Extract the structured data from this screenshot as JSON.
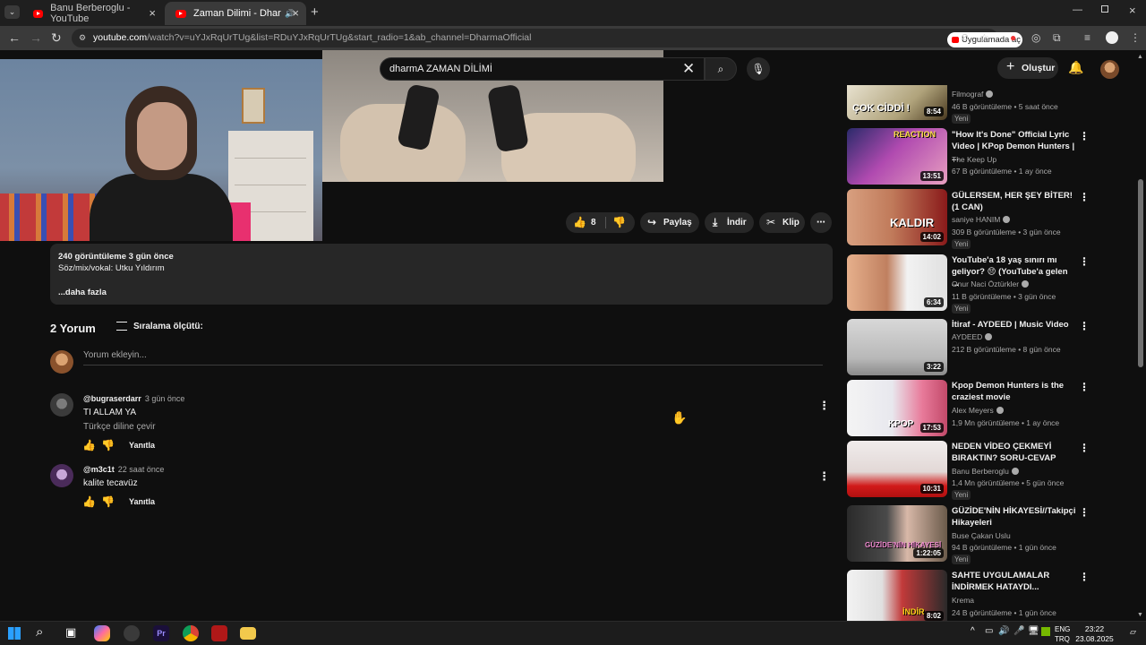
{
  "browser": {
    "tabs": [
      {
        "title": "Banu Berberoglu - YouTube",
        "active": false
      },
      {
        "title": "Zaman Dilimi - Dharma (Off",
        "active": true
      }
    ],
    "new_tab": "+",
    "url_domain": "youtube.com",
    "url_path": "/watch?v=uYJxRqUrTUg&list=RDuYJxRqUrTUg&start_radio=1&ab_channel=DharmaOfficial",
    "open_in_app": "Uygulamada aç"
  },
  "youtube": {
    "search_value": "dharmA ZAMAN DİLİMİ",
    "create_label": "Oluştur",
    "actions": {
      "likes": "8",
      "share": "Paylaş",
      "download": "İndir",
      "clip": "Klip"
    },
    "description": {
      "meta": "240 görüntüleme  3 gün önce",
      "line1": "Söz/mix/vokal: Utku Yıldırım",
      "more": "...daha fazla"
    },
    "comments_header": {
      "count": "2 Yorum",
      "sort": "Sıralama ölçütü:",
      "add_placeholder": "Yorum ekleyin..."
    },
    "comments": [
      {
        "user": "@bugraserdarr",
        "ago": "3 gün önce",
        "text": "TI ALLAM YA",
        "translate": "Türkçe diline çevir",
        "reply": "Yanıtla"
      },
      {
        "user": "@m3c1t",
        "ago": "22 saat önce",
        "text": "kalite tecavüz",
        "reply": "Yanıtla"
      }
    ],
    "sidebar": [
      {
        "title": "",
        "channel": "Filmograf",
        "meta": "46 B görüntüleme • 5 saat önce",
        "new": "Yeni",
        "duration": "8:54",
        "overlay": "ÇOK CİDDİ !"
      },
      {
        "title": "\"How It's Done\" Official Lyric Video | KPop Demon Hunters | ...",
        "channel": "The Keep Up",
        "meta": "67 B görüntüleme • 1 ay önce",
        "duration": "13:51",
        "overlay": "REACTION"
      },
      {
        "title": "GÜLERSEM, HER ŞEY BİTER! (1 CAN)",
        "channel": "saniye HANIM",
        "meta": "309 B görüntüleme • 3 gün önce",
        "new": "Yeni",
        "duration": "14:02",
        "overlay": "KALDIR"
      },
      {
        "title": "YouTube'a 18 yaş sınırı mı geliyor? 😔 (YouTube'a gelen ...",
        "channel": "Onur Naci Öztürkler",
        "meta": "11 B görüntüleme • 3 gün önce",
        "new": "Yeni",
        "duration": "6:34",
        "overlay": ""
      },
      {
        "title": "İtiraf - AYDEED | Music Video",
        "channel": "AYDEED",
        "meta": "212 B görüntüleme • 8 gün önce",
        "duration": "3:22",
        "overlay": ""
      },
      {
        "title": "Kpop Demon Hunters is the craziest movie",
        "channel": "Alex Meyers",
        "meta": "1,9 Mn görüntüleme • 1 ay önce",
        "duration": "17:53",
        "overlay": "KPOP"
      },
      {
        "title": "NEDEN VİDEO ÇEKMEYİ BIRAKTIN?  SORU-CEVAP",
        "channel": "Banu Berberoglu",
        "meta": "1,4 Mn görüntüleme • 5 gün önce",
        "new": "Yeni",
        "duration": "10:31",
        "overlay": ""
      },
      {
        "title": "GÜZİDE'NİN HİKAYESİ//Takipçi Hikayeleri",
        "channel": "Buse Çakan Uslu",
        "meta": "94 B görüntüleme • 1 gün önce",
        "new": "Yeni",
        "duration": "1:22:05",
        "overlay": "GÜZİDE'NİN HİKAYESİ"
      },
      {
        "title": "SAHTE UYGULAMALAR İNDİRMEK HATAYDI...",
        "channel": "Krema",
        "meta": "24 B görüntüleme • 1 gün önce",
        "duration": "8:02",
        "overlay": "İNDİR"
      }
    ]
  },
  "taskbar": {
    "lang1": "ENG",
    "lang2": "TRQ",
    "time": "23:22",
    "date": "23.08.2025"
  }
}
